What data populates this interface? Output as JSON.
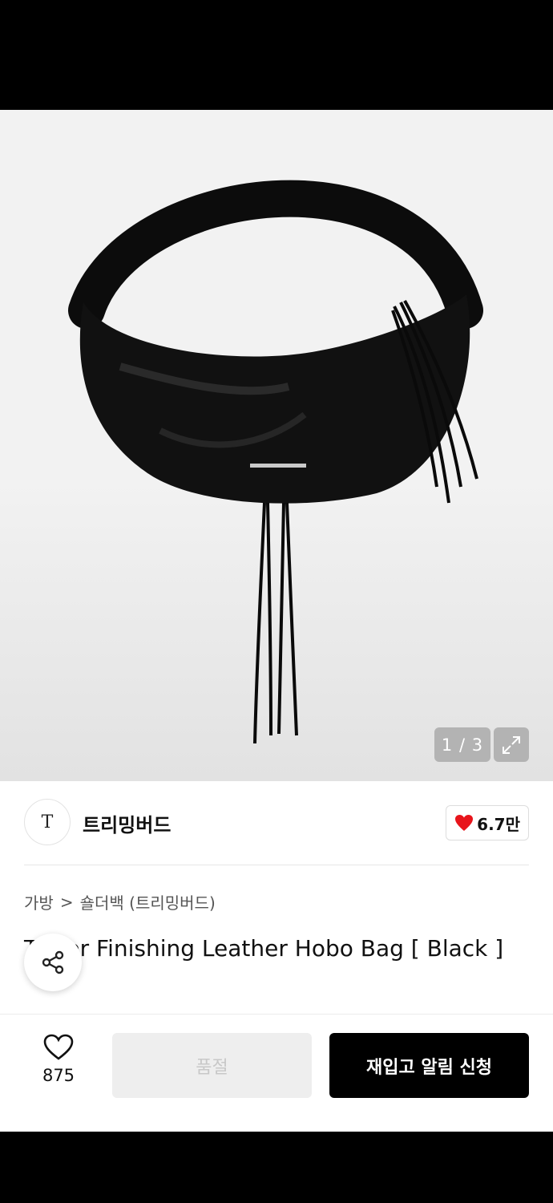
{
  "gallery": {
    "counter": "1 / 3"
  },
  "brand": {
    "logo_text": "T",
    "name": "트리밍버드",
    "like_count": "6.7만"
  },
  "breadcrumb": {
    "category": "가방",
    "separator": ">",
    "subcategory": "숄더백 (트리밍버드)"
  },
  "product": {
    "title": "Tower Finishing Leather Hobo Bag [ Black ]"
  },
  "actions": {
    "wish_count": "875",
    "soldout_label": "품절",
    "restock_label": "재입고 알림 신청"
  },
  "colors": {
    "accent": "#000000",
    "heart": "#e8141b",
    "soldout_bg": "#eeeeee"
  }
}
